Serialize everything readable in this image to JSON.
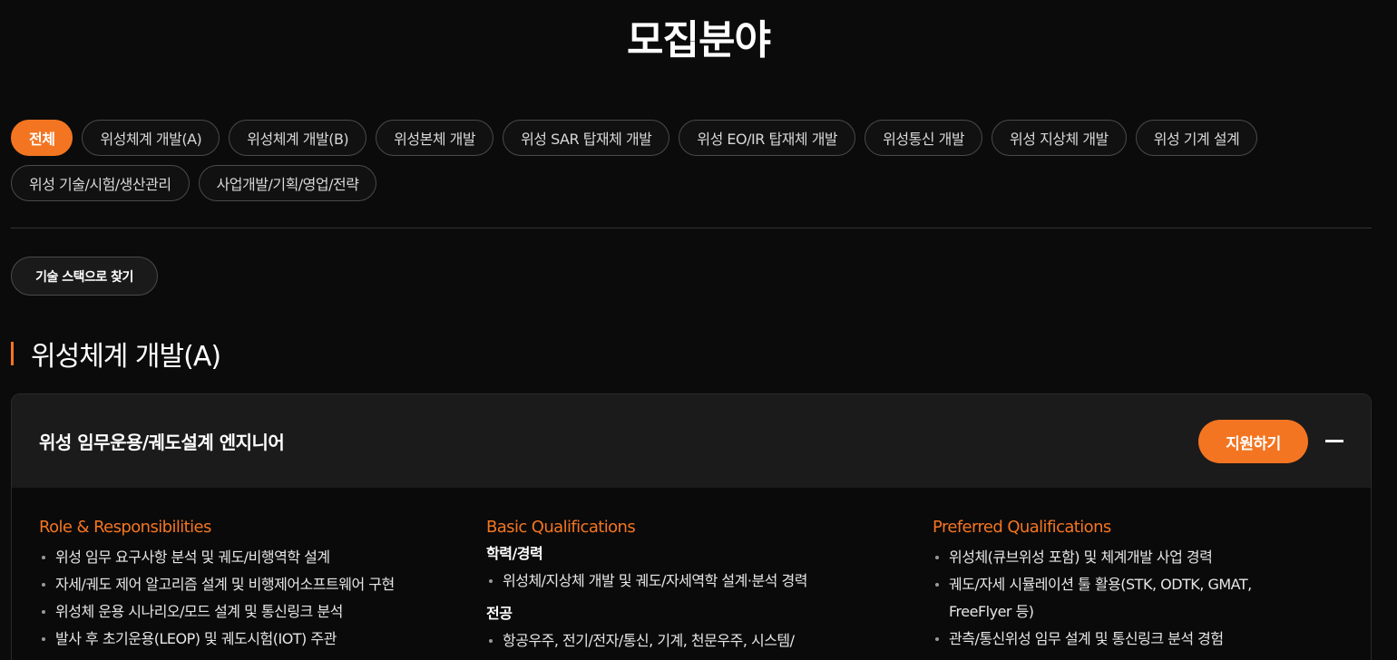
{
  "page_title": "모집분야",
  "filters": [
    {
      "label": "전체",
      "active": true
    },
    {
      "label": "위성체계 개발(A)",
      "active": false
    },
    {
      "label": "위성체계 개발(B)",
      "active": false
    },
    {
      "label": "위성본체 개발",
      "active": false
    },
    {
      "label": "위성 SAR 탑재체 개발",
      "active": false
    },
    {
      "label": "위성 EO/IR 탑재체 개발",
      "active": false
    },
    {
      "label": "위성통신 개발",
      "active": false
    },
    {
      "label": "위성 지상체 개발",
      "active": false
    },
    {
      "label": "위성 기계 설계",
      "active": false
    },
    {
      "label": "위성 기술/시험/생산관리",
      "active": false
    },
    {
      "label": "사업개발/기획/영업/전략",
      "active": false
    }
  ],
  "tech_stack_button": "기술 스택으로 찾기",
  "section_title": "위성체계 개발(A)",
  "job": {
    "title": "위성 임무운용/궤도설계 엔지니어",
    "apply_label": "지원하기",
    "collapse_icon": "minus-icon",
    "role": {
      "heading": "Role & Responsibilities",
      "items": [
        "위성 임무 요구사항 분석 및 궤도/비행역학 설계",
        "자세/궤도 제어 알고리즘 설계 및 비행제어소프트웨어 구현",
        "위성체 운용 시나리오/모드 설계 및 통신링크 분석",
        "발사 후 초기운용(LEOP) 및 궤도시험(IOT) 주관"
      ]
    },
    "basic": {
      "heading": "Basic Qualifications",
      "groups": [
        {
          "title": "학력/경력",
          "items": [
            "위성체/지상체 개발 및 궤도/자세역학 설계·분석 경력"
          ]
        },
        {
          "title": "전공",
          "items": [
            "항공우주, 전기/전자/통신, 기계, 천문우주, 시스템/"
          ]
        }
      ]
    },
    "preferred": {
      "heading": "Preferred Qualifications",
      "items": [
        "위성체(큐브위성 포함) 및 체계개발 사업 경력",
        "궤도/자세 시뮬레이션 툴 활용(STK, ODTK, GMAT, FreeFlyer 등)",
        "관측/통신위성 임무 설계 및 통신링크 분석 경험"
      ]
    }
  },
  "colors": {
    "accent": "#f47521",
    "background": "#0b0b0b",
    "card_header": "#1b1b1b"
  }
}
